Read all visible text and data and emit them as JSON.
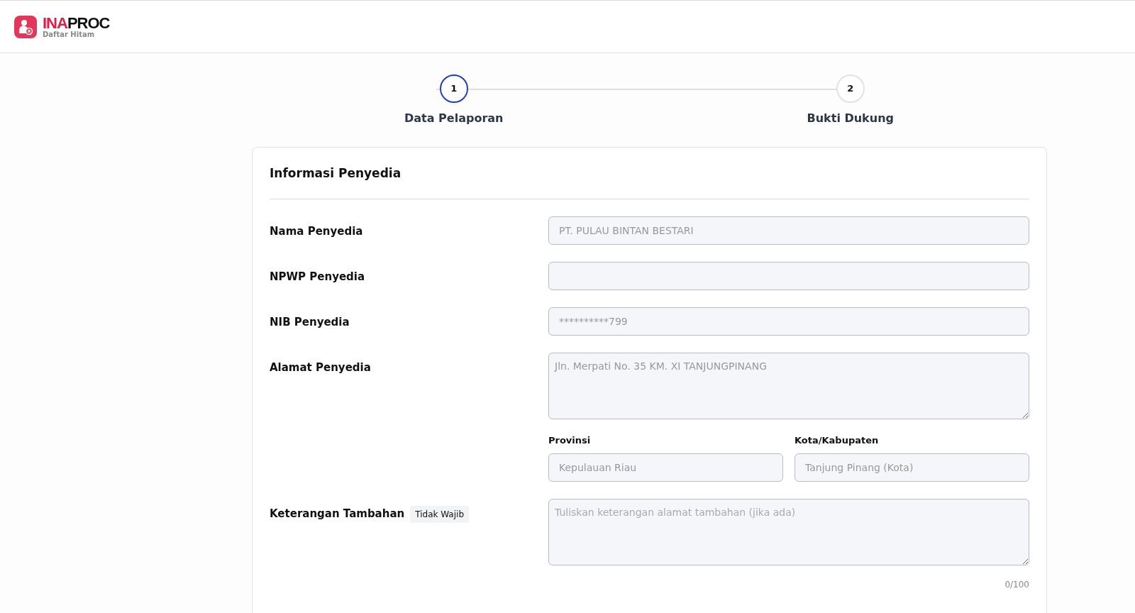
{
  "header": {
    "logo_brand_a": "INA",
    "logo_brand_b": "PROC",
    "logo_subtitle": "Daftar Hitam"
  },
  "steps": [
    {
      "number": "1",
      "label": "Data Pelaporan",
      "selected": true
    },
    {
      "number": "2",
      "label": "Bukti Dukung",
      "selected": false
    }
  ],
  "card": {
    "title": "Informasi Penyedia",
    "fields": [
      {
        "kind": "input",
        "label": "Nama Penyedia",
        "value": "PT. PULAU BINTAN BESTARI"
      },
      {
        "kind": "input",
        "label": "NPWP Penyedia"
      },
      {
        "kind": "input",
        "label": "NIB Penyedia",
        "value": "**********799"
      },
      {
        "kind": "textarea",
        "label": "Alamat Penyedia",
        "value": "Jln. Merpati No. 35 KM. XI TANJUNGPINANG",
        "subfields": [
          {
            "label": "Provinsi",
            "value": "Kepulauan Riau"
          },
          {
            "label": "Kota/Kabupaten",
            "value": "Tanjung Pinang (Kota)"
          }
        ]
      },
      {
        "kind": "textarea",
        "label": "Keterangan Tambahan",
        "tag": "Tidak Wajib",
        "placeholder": "Tuliskan keterangan alamat tambahan (jika ada)",
        "counter": "0/100"
      }
    ]
  }
}
